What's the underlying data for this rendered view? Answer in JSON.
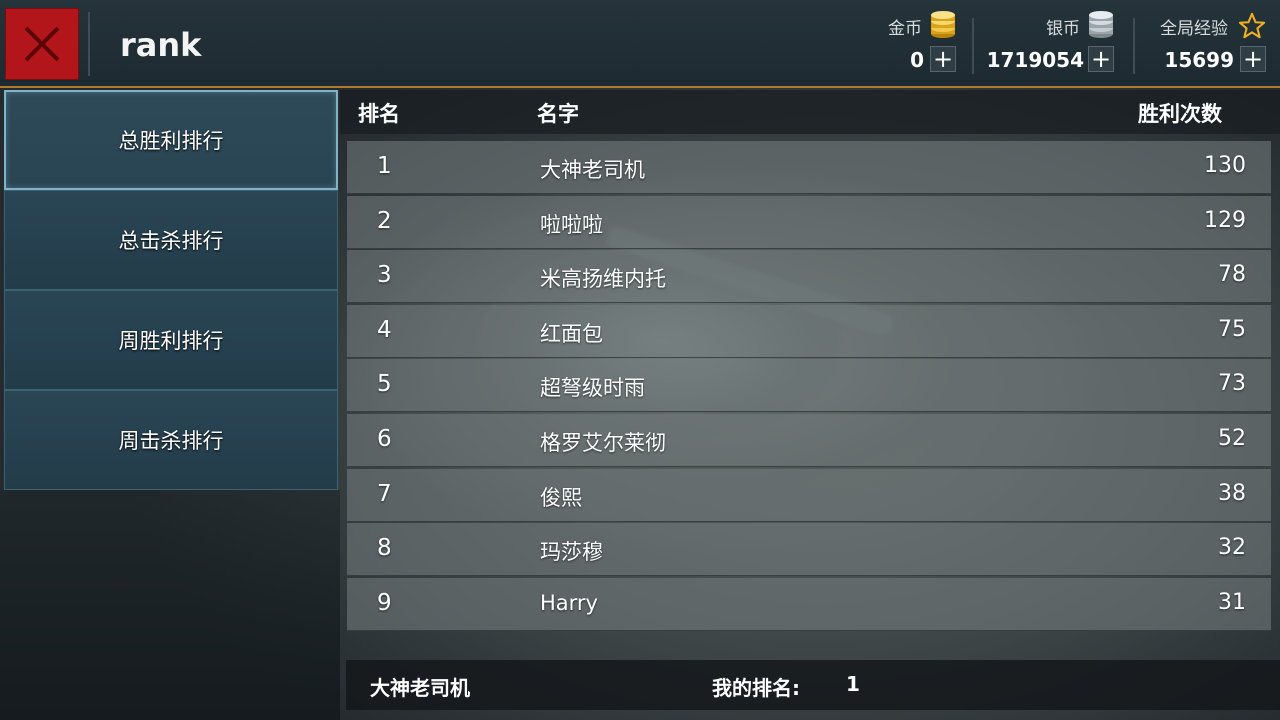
{
  "header": {
    "title": "rank",
    "close_icon": "close-icon",
    "currencies": [
      {
        "label": "金币",
        "value": "0",
        "icon": "gold-coin-icon",
        "color": "#e8b92a"
      },
      {
        "label": "银币",
        "value": "1719054",
        "icon": "silver-coin-icon",
        "color": "#b8c2c8"
      },
      {
        "label": "全局经验",
        "value": "15699",
        "icon": "star-icon",
        "color": "#f0b020"
      }
    ],
    "plus_label": "+"
  },
  "sidebar": {
    "items": [
      {
        "label": "总胜利排行",
        "active": true
      },
      {
        "label": "总击杀排行",
        "active": false
      },
      {
        "label": "周胜利排行",
        "active": false
      },
      {
        "label": "周击杀排行",
        "active": false
      }
    ]
  },
  "table": {
    "columns": [
      "排名",
      "名字",
      "胜利次数"
    ],
    "rows": [
      {
        "rank": "1",
        "name": "大神老司机",
        "wins": "130"
      },
      {
        "rank": "2",
        "name": "啦啦啦",
        "wins": "129"
      },
      {
        "rank": "3",
        "name": "米高扬维内托",
        "wins": "78"
      },
      {
        "rank": "4",
        "name": "红面包",
        "wins": "75"
      },
      {
        "rank": "5",
        "name": "超弩级时雨",
        "wins": "73"
      },
      {
        "rank": "6",
        "name": "格罗艾尔莱彻",
        "wins": "52"
      },
      {
        "rank": "7",
        "name": "俊熙",
        "wins": "38"
      },
      {
        "rank": "8",
        "name": "玛莎穆",
        "wins": "32"
      },
      {
        "rank": "9",
        "name": "Harry",
        "wins": "31"
      }
    ]
  },
  "footer": {
    "my_name": "大神老司机",
    "my_rank_label": "我的排名:",
    "my_rank_value": "1"
  },
  "colors": {
    "accent_red": "#b3161a",
    "header_border": "#b07a2a",
    "sidebar_active_border": "#7fb4c8"
  }
}
